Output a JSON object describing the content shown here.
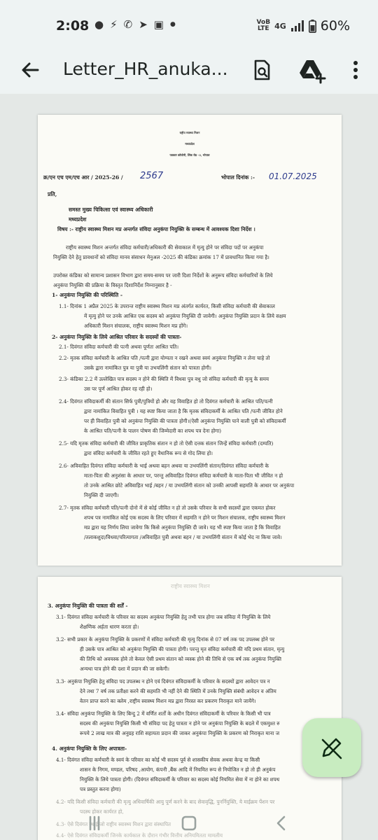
{
  "status_bar": {
    "time": "2:08",
    "notification_icons": [
      "chat-bubble-icon",
      "messenger-icon",
      "missed-call-icon",
      "telegram-icon",
      "instagram-icon",
      "dot-icon"
    ],
    "network_label_top": "VoB",
    "network_label_bottom": "LTE",
    "network_type": "4G",
    "battery": "60%"
  },
  "app_bar": {
    "title": "Letter_HR_anuka..."
  },
  "document": {
    "page1": {
      "header1": "राष्ट्रीय स्वास्थ्य मिशन",
      "header2": "मध्यप्रदेश",
      "header3": "पत्रकार कॉलोनी, लिंक रोड -3, भोपाल",
      "ref_label": "क्र/एन एच एम/एच आर / 2025-26 /",
      "ref_number": "2567",
      "date_label": "भोपाल दिनांक :-",
      "date_value": "01.07.2025",
      "to": "प्रति,",
      "recipient1": "समस्त मुख्य चिकित्सा एवं स्वास्थ्य अधिकारी",
      "recipient2": "मध्यप्रदेश",
      "subject": "विषय :- राष्ट्रीय स्वास्थ्य मिशन मप्र अन्तर्गत संविदा अनुकंपा नियुक्ति के सम्बन्ध में आवश्यक दिशा निर्देश ।",
      "lines": [
        "राष्ट्रीय स्वास्थ्य मिशन अन्तर्गत संविदा कर्मचारी/अधिकारी की सेवाकाल में मृत्यु होने पर संविदा पदों पर अनुकंपा",
        "नियुक्ति देने हेतु प्रावधानों को संविदा मानव संसाधन मेनुअल -2025 की कंडिका क्रमांक 17 में प्रावधानित किया गया है।",
        "उपरोक्त कंडिका को सामान्य प्रशासन विभाग द्वारा समय-समय पर जारी दिशा निर्देशों के अनुरूप संविदा कर्मचारियों के लिये",
        "अनुकंपा नियुक्ति की प्रक्रिया के विस्तृत दिशानिर्देश निम्नानुसार है -",
        "1-  अनुकंपा नियुक्ति की परिस्थिति -",
        "1.1-    दिनांक 1 अप्रैल 2025 के उपरान्त राष्ट्रीय स्वास्थ्य मिशन मप्र अंतर्गत कार्यरत, किसी संविदा कर्मचारी की सेवाकाल",
        "में मृत्यु होने पर उनके आश्रित एक सदस्य को अनुकंपा नियुक्ति दी जावेगी। अनुकंपा नियुक्ति प्रदान के लिये सक्षम",
        "अधिकारी मिशन संचालक, राष्ट्रीय स्वास्थ्य मिशन मप्र होंगे।",
        "2- अनुकंपा नियुक्ति के लिये आश्रित परिवार के सदस्यों की पात्रता-",
        "2.1-    दिवंगत संविदा कर्मचारी की पत्नी अथवा पूर्णतः आश्रित पति।",
        "2.2-    मृतक संविदा कर्मचारी के आश्रित पति /पत्नी द्वारा योग्यता न रखने अथवा स्वयं अनुकंपा नियुक्ति न लेना चाहे तो",
        "उसके द्वारा नामांकित पुत्र या पुत्री या उभयलिंगी संतान को पात्रता होगी।",
        "2.3-    कंडिका 2.2 में उल्लेखित पात्र सदस्य न होने की स्थिति में विधवा पुत्र वधु जो संविदा कर्मचारी की मृत्यु के समय",
        "उस पर पूर्ण आश्रित होकर रह रही हो।",
        "2.4-    दिवंगत संविदाकर्मी की संतान सिर्फ पुत्री/पुत्रियों हो और वह विवाहित हो तो दिवंगत कर्मचारी के आश्रित पति/पत्नी",
        "द्वारा नामांकित विवाहित पुत्री । यह स्पष्ट किया जाता है कि मृतक संविदाकर्मी के आश्रित पति /पत्नी जीवित होने",
        "पर ही विवाहित पुत्री को अनुकंपा नियुक्ति की पात्रता होगी।(ऐसी अनुकंपा नियुक्ति पाने वाली पुत्री को संविदाकर्मी",
        "के आश्रित पति/पत्नी के पालन पोषण की जिम्मेदारी का शपथ पत्र देना होगा)",
        "2.5-    यदि मृतक संविदा कर्मचारी की जीवित प्राकृतिक संतान न हो तो ऐसी दत्तक संतान जिन्हें संविदा कर्मचारी (दम्पति)",
        "द्वारा संविदा कर्मचारी के जीवित रहते हुए वैधानिक रूप से गोद लिया हो।",
        "2.6-    अविवाहित दिवंगत संविदा कर्मचारी के भाई अथवा बहन अथवा या उभयलिंगी संतान/दिवंगत संविदा कर्मचारी के",
        "माता-पिता की अनुशंसा के आधार पर, परन्तु अविवाहित दिवंगत संविदा कर्मचारी के माता-पिता भी जीवित न हो",
        "तो उनके आश्रित छोटे अविवाहित भाई /बहन / या उभयलिंगी संतान को उनकी आपसी सहमति के आधार पर अनुकंपा",
        "नियुक्ति दी जाएगी।",
        "2.7-    मृतक संविदा कर्मचारी पति/पत्नी दोनो में से कोई जीवित न हो तो उसके परिवार के सभी सदस्यों द्वारा एकमत होकर",
        "शपथ पत्र नामांकित कोई एक सदस्य के लिए परिवार में सहमति न होने पर मिशन संचालक, राष्ट्रीय स्वास्थ्य मिशन",
        "मप्र द्वारा यह निर्णय लिया जावेगा कि किसे अनुकंपा नियुक्ति दी जावे। यह भी स्पष्ट किया जाता है कि विवाहित",
        "/तलाकशुदा/विधवा/परित्यागता /अविवाहित पुत्री अथवा बहन / या उभयलिंगी संतान में कोई भेद ना किया जावे।"
      ]
    },
    "page2": {
      "faint_header": "राष्ट्रीय स्वास्थ्य मिशन",
      "lines": [
        "3.  अनुकंपा नियुक्ति की पात्रता की शर्तें -",
        "3.1-    दिवंगत संविदा कर्मचारी के परिवार का सदस्य अनुकंपा नियुक्ति हेतु तभी पात्र होगा जब संविदा में नियुक्ति के लिये",
        "शैक्षणिक अर्हता धारण करता हो।",
        "3.2-    सभी प्रकार के अनुकंपा नियुक्ति के प्रकरणों में संविदा कर्मचारी की मृत्यु दिनांक से 07 वर्ष तक पद उपलब्ध होने पर",
        "ही उसके पात्र आश्रित को अनुकंपा नियुक्ति की पात्रता होगी। परन्तु मृत संविदा कर्मचारी की यदि प्रथम संतान, मृत्यु",
        "की तिथि को अवयस्क होवे तो केवल ऐसी प्रथम संतान को व्यस्क होने की तिथि से एक वर्ष तक अनुकंपा नियुक्ति",
        "अन्यथा पात्र होने की दशा में प्रदान की जा सकेगी।",
        "3.3-    अनुकंपा नियुक्ति हेतु संविदा पद उपलब्ध न होने एवं दिवंगत संविदाकर्मी के परिवार के सदस्यों द्वारा आवेदन पत्र न",
        "देने तथा 7 वर्ष तक प्रतीक्षा करने की सहमति भी नहीं देने की स्थिति में उनके नियुक्ति संबंधी आवेदन व अंतिम",
        "वेतन प्राप्त करने का क्लेम ,राष्ट्रीय स्वास्थ्य मिशन मप्र द्वारा निरस्त कर प्रकरण निराकृत माने जायेंगे।",
        "3.4-    संविदा अनुकंपा नियुक्ति के लिए बिन्दु 2 में वर्णित शर्तों के अधीन दिवंगत संविदाकर्मी के परिवार के किसी भी पात्र",
        "सदस्य की अनुकंपा नियुक्ति किसी भी संविदा पद हेतु पात्रता न होने पर अनुकंपा नियुक्ति के बदले में एकमुश्त रु",
        "रूपये 2 लाख मात्र की अनुग्रह राशि सहायता प्रदान की जाकर अनुकंपा नियुक्ति के प्रकरण को निराकृत माना ज",
        "4.  अनुकंपा नियुक्ति के लिए अपात्रता-",
        "4.1-    दिवंगत संविदा कर्मचारी के स्वयं के परिवार का कोई भी सदस्य पूर्व से शासकीय सेवक अथवा केन्द्र या किसी",
        "शासन के निगम, मण्डल, परिषद ,आयोग, कंपनी ,बैंक आदि में नियमित रूप से नियोजित न हो तो ही अनुकंप",
        "नियुक्ति के लिये पात्रता होगी। (दिवंगत संविदाकर्मी के परिवार का सदस्य कोई नियमित सेवा में ना होने का शपथ",
        "पत्र प्रस्तुत करना होगा)",
        "4.2-    यदि किसी संविदा कर्मचारी की मृत्यु अधिवार्षिकी आयु पूर्ण करने के बाद सेवावृद्धि, पुनर्नियुक्ति, ये माईक्रम पेंशन पर",
        "पदस्थ होकर कार्यरत हो,",
        "4.3-    ऐसे दिवंगत स्थाई जो राष्ट्रीय स्वास्थ्य मिशन द्वारा संस्थापित",
        "4.4-    ऐसे दिवंगत संविदाकर्मी जिनके कार्यकाल के दौरान गंभीर वित्तीय अनियमितता मामलीय"
      ]
    }
  }
}
